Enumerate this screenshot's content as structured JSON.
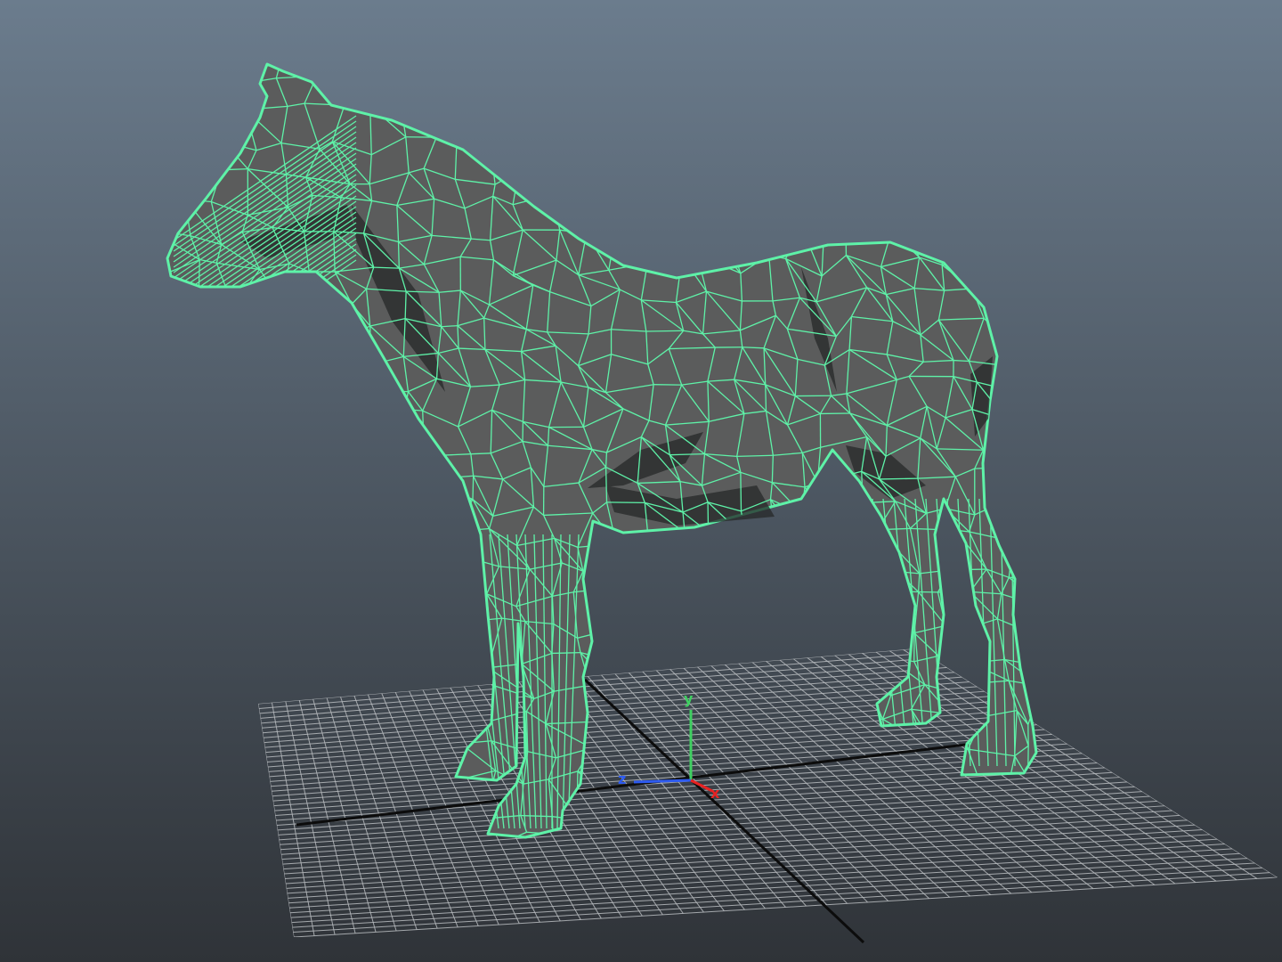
{
  "viewport": {
    "background_top": "#6b7c8d",
    "background_bottom": "#2f3338"
  },
  "model": {
    "wireframe_color": "#5ef2a8",
    "shading_color": "#5b5c5c",
    "shadow_color": "#262828"
  },
  "grid": {
    "line_color": "#b9bcbf",
    "axis_line_color": "#0c0c0c"
  },
  "axes_gizmo": {
    "y": {
      "label": "y",
      "color": "#3fd061"
    },
    "z": {
      "label": "z",
      "color": "#2e5bf0"
    },
    "x": {
      "label": "x",
      "color": "#e82222"
    }
  }
}
